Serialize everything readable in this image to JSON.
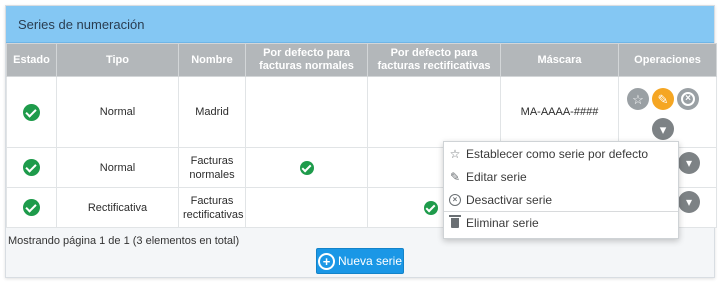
{
  "panel": {
    "title": "Series de numeración"
  },
  "table": {
    "headers": [
      "Estado",
      "Tipo",
      "Nombre",
      "Por defecto para facturas normales",
      "Por defecto para facturas rectificativas",
      "Máscara",
      "Operaciones"
    ],
    "rows": [
      {
        "estado": "active",
        "tipo": "Normal",
        "nombre": "Madrid",
        "default_normal": false,
        "default_rect": false,
        "mascara": "MA-AAAA-####"
      },
      {
        "estado": "active",
        "tipo": "Normal",
        "nombre": "Facturas normales",
        "default_normal": true,
        "default_rect": false,
        "mascara": ""
      },
      {
        "estado": "active",
        "tipo": "Rectificativa",
        "nombre": "Facturas rectificativas",
        "default_normal": false,
        "default_rect": true,
        "mascara": ""
      }
    ]
  },
  "icons": {
    "star": "☆",
    "pencil": "✎",
    "x": "×",
    "chevron": "▾",
    "plus": "+"
  },
  "pager": {
    "text": "Mostrando página 1 de 1 (3 elementos en total)"
  },
  "new_button": {
    "label": "Nueva serie"
  },
  "context_menu": {
    "items": [
      {
        "label": "Establecer como serie por defecto",
        "icon": "star-icon"
      },
      {
        "label": "Editar serie",
        "icon": "pencil-icon"
      },
      {
        "label": "Desactivar serie",
        "icon": "x-circle-icon"
      },
      {
        "label": "Eliminar serie",
        "icon": "trash-icon"
      }
    ]
  },
  "colors": {
    "header_bg": "#84c7f3",
    "table_header_bg": "#b3b7ba",
    "check_green": "#1e9b4b",
    "edit_orange": "#f5a623",
    "primary_blue": "#1a97e6"
  }
}
